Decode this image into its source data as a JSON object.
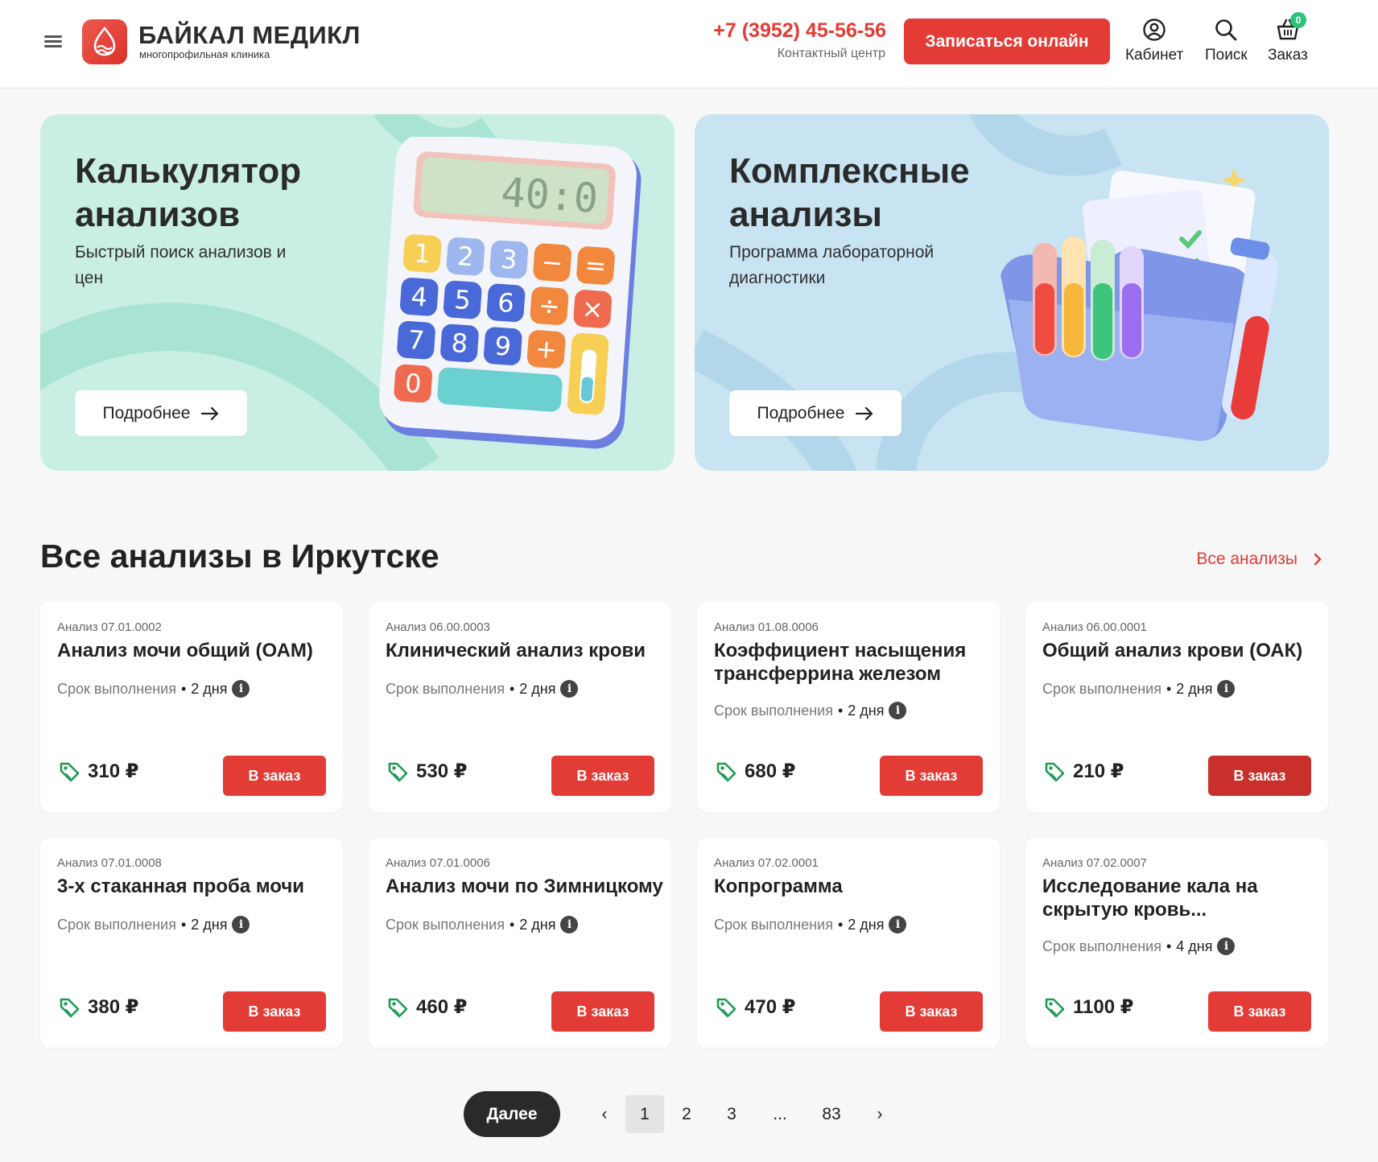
{
  "header": {
    "brand_name": "БАЙКАЛ МЕДИКЛ",
    "brand_sub": "многопрофильная клиника",
    "phone": "+7 (3952) 45-56-56",
    "phone_caption": "Контактный центр",
    "signup_label": "Записаться онлайн",
    "cabinet_label": "Кабинет",
    "search_label": "Поиск",
    "order_label": "Заказ",
    "cart_count": "0"
  },
  "banners": {
    "calc": {
      "title": "Калькулятор анализов",
      "subtitle": "Быстрый поиск анализов и цен",
      "button": "Подробнее",
      "display_value": "40:0"
    },
    "complex": {
      "title": "Комплексные анализы",
      "subtitle": "Программа лабораторной диагностики",
      "button": "Подробнее"
    }
  },
  "section": {
    "title": "Все анализы в Иркутске",
    "all_link": "Все анализы"
  },
  "labels": {
    "term": "Срок выполнения",
    "order": "В заказ"
  },
  "cards": [
    {
      "code": "Анализ 07.01.0002",
      "title": "Анализ мочи общий (ОАМ)",
      "term": "2 дня",
      "price": "310 ₽"
    },
    {
      "code": "Анализ 06.00.0003",
      "title": "Клинический анализ крови",
      "term": "2 дня",
      "price": "530 ₽"
    },
    {
      "code": "Анализ 01.08.0006",
      "title": "Коэффициент насыщения трансферрина железом",
      "term": "2 дня",
      "price": "680 ₽"
    },
    {
      "code": "Анализ 06.00.0001",
      "title": "Общий анализ крови (ОАК)",
      "term": "2 дня",
      "price": "210 ₽"
    },
    {
      "code": "Анализ 07.01.0008",
      "title": "3-х стаканная проба мочи",
      "term": "2 дня",
      "price": "380 ₽"
    },
    {
      "code": "Анализ 07.01.0006",
      "title": "Анализ мочи по Зимницкому",
      "term": "2 дня",
      "price": "460 ₽"
    },
    {
      "code": "Анализ 07.02.0001",
      "title": "Копрограмма",
      "term": "2 дня",
      "price": "470 ₽"
    },
    {
      "code": "Анализ 07.02.0007",
      "title": "Исследование кала на скрытую кровь...",
      "term": "4 дня",
      "price": "1100 ₽"
    }
  ],
  "pagination": {
    "next_label": "Далее",
    "prev_arrow": "‹",
    "next_arrow": "›",
    "pages": [
      "1",
      "2",
      "3",
      "...",
      "83"
    ],
    "current": "1"
  },
  "colors": {
    "accent": "#e33b35",
    "calc_banner_bg": "#c9efe4",
    "complex_banner_bg": "#c8e4f2",
    "cart_badge": "#2ec37a",
    "price_tag_icon": "#1f9a55"
  }
}
